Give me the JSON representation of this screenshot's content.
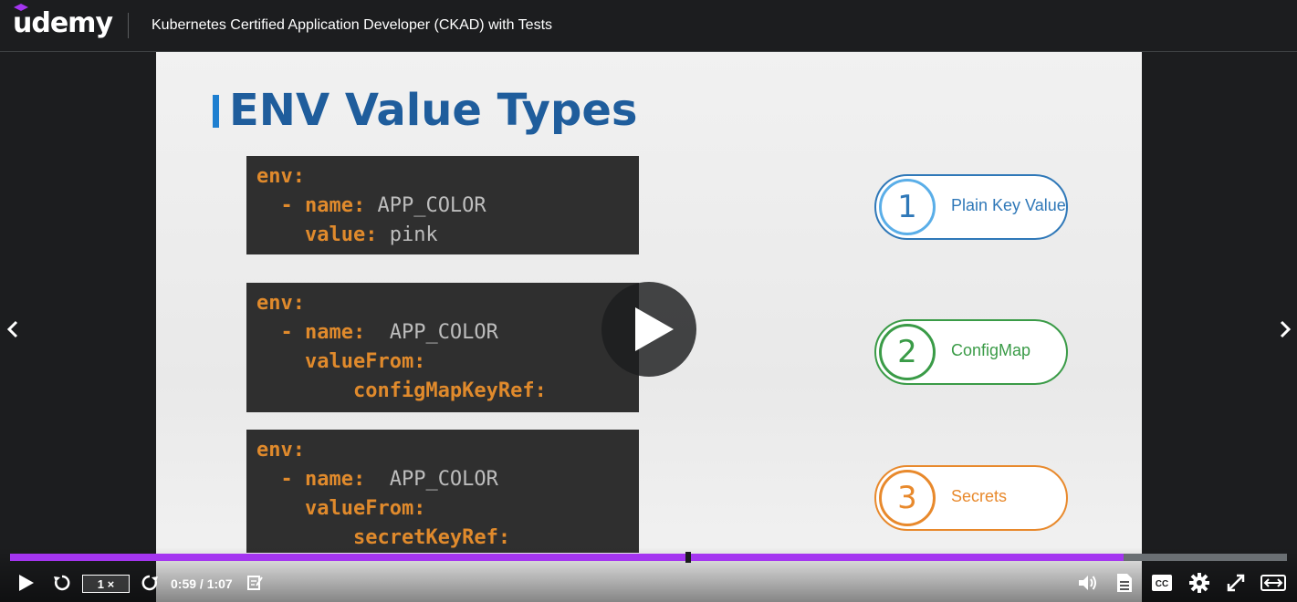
{
  "header": {
    "logo": "udemy",
    "course_title": "Kubernetes Certified Application Developer (CKAD) with Tests"
  },
  "slide": {
    "title": "ENV Value Types",
    "blocks": [
      {
        "lines": [
          [
            "env:",
            ""
          ],
          [
            "  - name:",
            " APP_COLOR"
          ],
          [
            "    value:",
            " pink"
          ]
        ]
      },
      {
        "lines": [
          [
            "env:",
            ""
          ],
          [
            "  - name:",
            "  APP_COLOR"
          ],
          [
            "    valueFrom:",
            ""
          ],
          [
            "        configMapKeyRef:",
            ""
          ]
        ]
      },
      {
        "lines": [
          [
            "env:",
            ""
          ],
          [
            "  - name:",
            "  APP_COLOR"
          ],
          [
            "    valueFrom:",
            ""
          ],
          [
            "        secretKeyRef:",
            ""
          ]
        ]
      }
    ],
    "types": [
      {
        "num": "1",
        "label": "Plain Key Value",
        "color": "#2f78b8"
      },
      {
        "num": "2",
        "label": "ConfigMap",
        "color": "#3a9b47"
      },
      {
        "num": "3",
        "label": "Secrets",
        "color": "#e8892c"
      }
    ]
  },
  "player": {
    "speed": "1 ×",
    "time": "0:59 / 1:07",
    "progress_fraction": 0.872,
    "marker_fraction": 0.529,
    "accent": "#a435f0"
  }
}
